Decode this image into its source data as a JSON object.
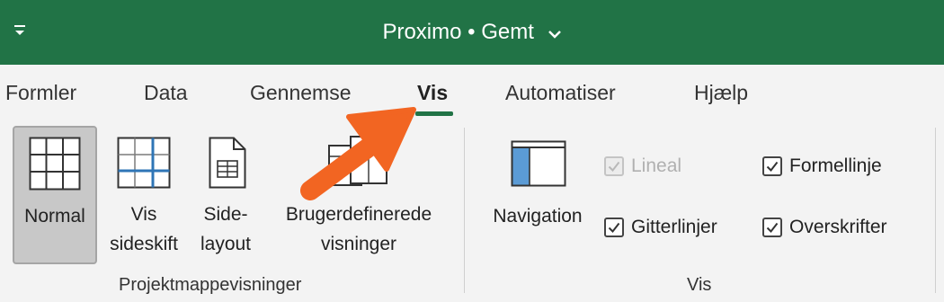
{
  "window": {
    "title": "Proximo • Gemt",
    "title_chevron_icon": "chevron-down-icon",
    "qat_icon": "customize-quick-access-icon"
  },
  "tabs": [
    {
      "label": "Formler"
    },
    {
      "label": "Data"
    },
    {
      "label": "Gennemse"
    },
    {
      "label": "Vis",
      "active": true
    },
    {
      "label": "Automatiser"
    },
    {
      "label": "Hjælp"
    }
  ],
  "ribbon": {
    "workbook_views": {
      "group_label": "Projektmappevisninger",
      "normal": {
        "label": "Normal",
        "selected": true
      },
      "page_break": {
        "line1": "Vis",
        "line2": "sideskift"
      },
      "page_layout": {
        "line1": "Side-",
        "line2": "layout"
      },
      "custom_views": {
        "line1": "Brugerdefinerede",
        "line2": "visninger"
      }
    },
    "show": {
      "group_label": "Vis",
      "navigation": {
        "label": "Navigation"
      },
      "ruler": {
        "label": "Lineal",
        "checked": true,
        "disabled": true
      },
      "formula_bar": {
        "label": "Formellinje",
        "checked": true
      },
      "gridlines": {
        "label": "Gitterlinjer",
        "checked": true
      },
      "headings": {
        "label": "Overskrifter",
        "checked": true
      }
    }
  },
  "colors": {
    "title_bar": "#217346",
    "active_tab_underline": "#217346",
    "annotation_arrow": "#f26522",
    "navigation_pane_fill": "#5b9bd5"
  }
}
